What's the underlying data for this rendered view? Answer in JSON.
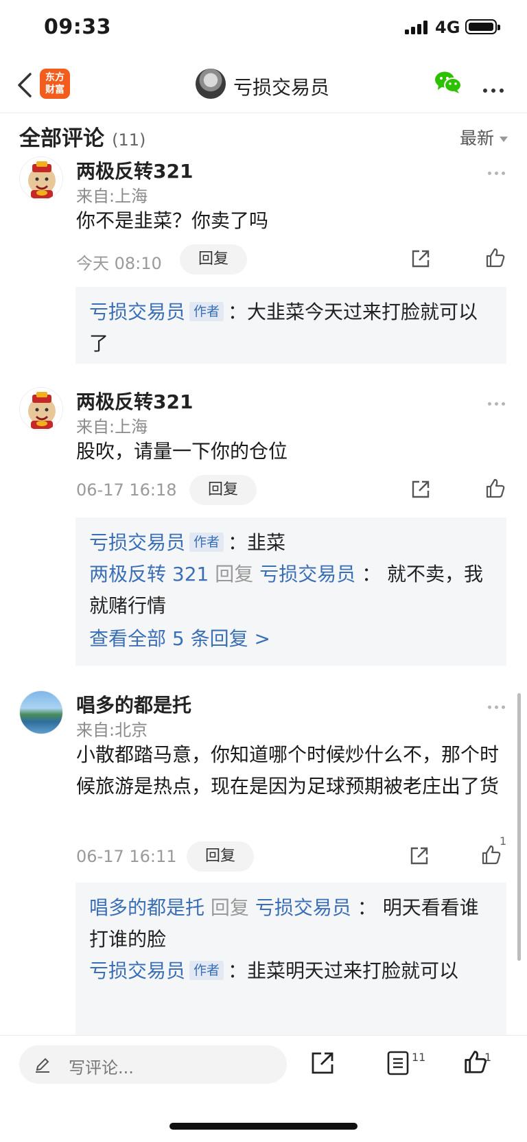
{
  "status_bar": {
    "time": "09:33",
    "network": "4G"
  },
  "nav": {
    "app_logo_line1": "东方",
    "app_logo_line2": "财富",
    "title": "亏损交易员"
  },
  "comments_header": {
    "title": "全部评论",
    "count": "(11)",
    "sort": "最新"
  },
  "comments": [
    {
      "user": "两极反转321",
      "location": "来自:上海",
      "text": "你不是韭菜？你卖了吗",
      "time": "今天 08:10",
      "reply_label": "回复",
      "like_count": "",
      "replies": [
        {
          "author": "亏损交易员",
          "badge": "作者",
          "sep": "：",
          "text": "大韭菜今天过来打脸就可以了"
        }
      ]
    },
    {
      "user": "两极反转321",
      "location": "来自:上海",
      "text": "股吹，请量一下你的仓位",
      "time": "06-17 16:18",
      "reply_label": "回复",
      "like_count": "",
      "replies": [
        {
          "author": "亏损交易员",
          "badge": "作者",
          "sep": "：",
          "text": "韭菜"
        },
        {
          "author": "两极反转 321",
          "verb": "回复",
          "target": "亏损交易员",
          "sep": "：",
          "text": "就不卖，我就赌行情"
        }
      ],
      "view_all": "查看全部 5 条回复 >"
    },
    {
      "user": "唱多的都是托",
      "location": "来自:北京",
      "text": "小散都踏马意，你知道哪个时候炒什么不，那个时候旅游是热点，现在是因为足球预期被老庄出了货",
      "time": "06-17 16:11",
      "reply_label": "回复",
      "like_count": "1",
      "replies": [
        {
          "author": "唱多的都是托",
          "verb": "回复",
          "target": "亏损交易员",
          "sep": "：",
          "text": "明天看看谁打谁的脸"
        },
        {
          "author": "亏损交易员",
          "badge": "作者",
          "sep": "：",
          "text": "韭菜明天过来打脸就可以"
        }
      ]
    }
  ],
  "bottom_bar": {
    "placeholder": "写评论...",
    "comment_count": "11",
    "like_count": "1"
  }
}
